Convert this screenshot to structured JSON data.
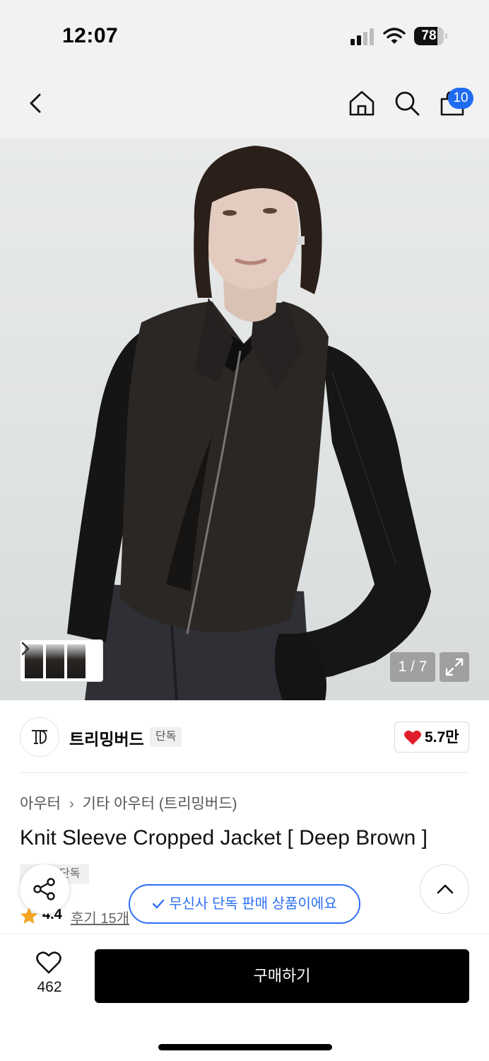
{
  "status_bar": {
    "time": "12:07",
    "battery_level": "78",
    "battery_fraction": 0.78,
    "icons": [
      "cellular-signal-icon",
      "wifi-icon",
      "battery-icon"
    ]
  },
  "nav": {
    "icons": [
      "back-chevron-icon",
      "home-icon",
      "search-icon",
      "shopping-bag-icon"
    ],
    "cart_badge": "10",
    "accent_color": "#1f6bf0"
  },
  "gallery": {
    "counter": "1 / 7",
    "thumbnail_count": 3
  },
  "brand": {
    "logo_text": "TB",
    "name": "트리밍버드",
    "tag": "단독",
    "likes": "5.7만"
  },
  "product": {
    "breadcrumb": [
      "아우터",
      "기타 아우터 (트리밍버드)"
    ],
    "title": "Knit Sleeve Cropped Jacket [ Deep Brown ]",
    "tag": "단독",
    "rating": "4.4",
    "reviews": "후기 15개"
  },
  "banner": {
    "text": "무신사 단독 판매 상품이에요",
    "color": "#2d6ff3"
  },
  "bottom_bar": {
    "wish_count": "462",
    "buy_label": "구매하기"
  }
}
